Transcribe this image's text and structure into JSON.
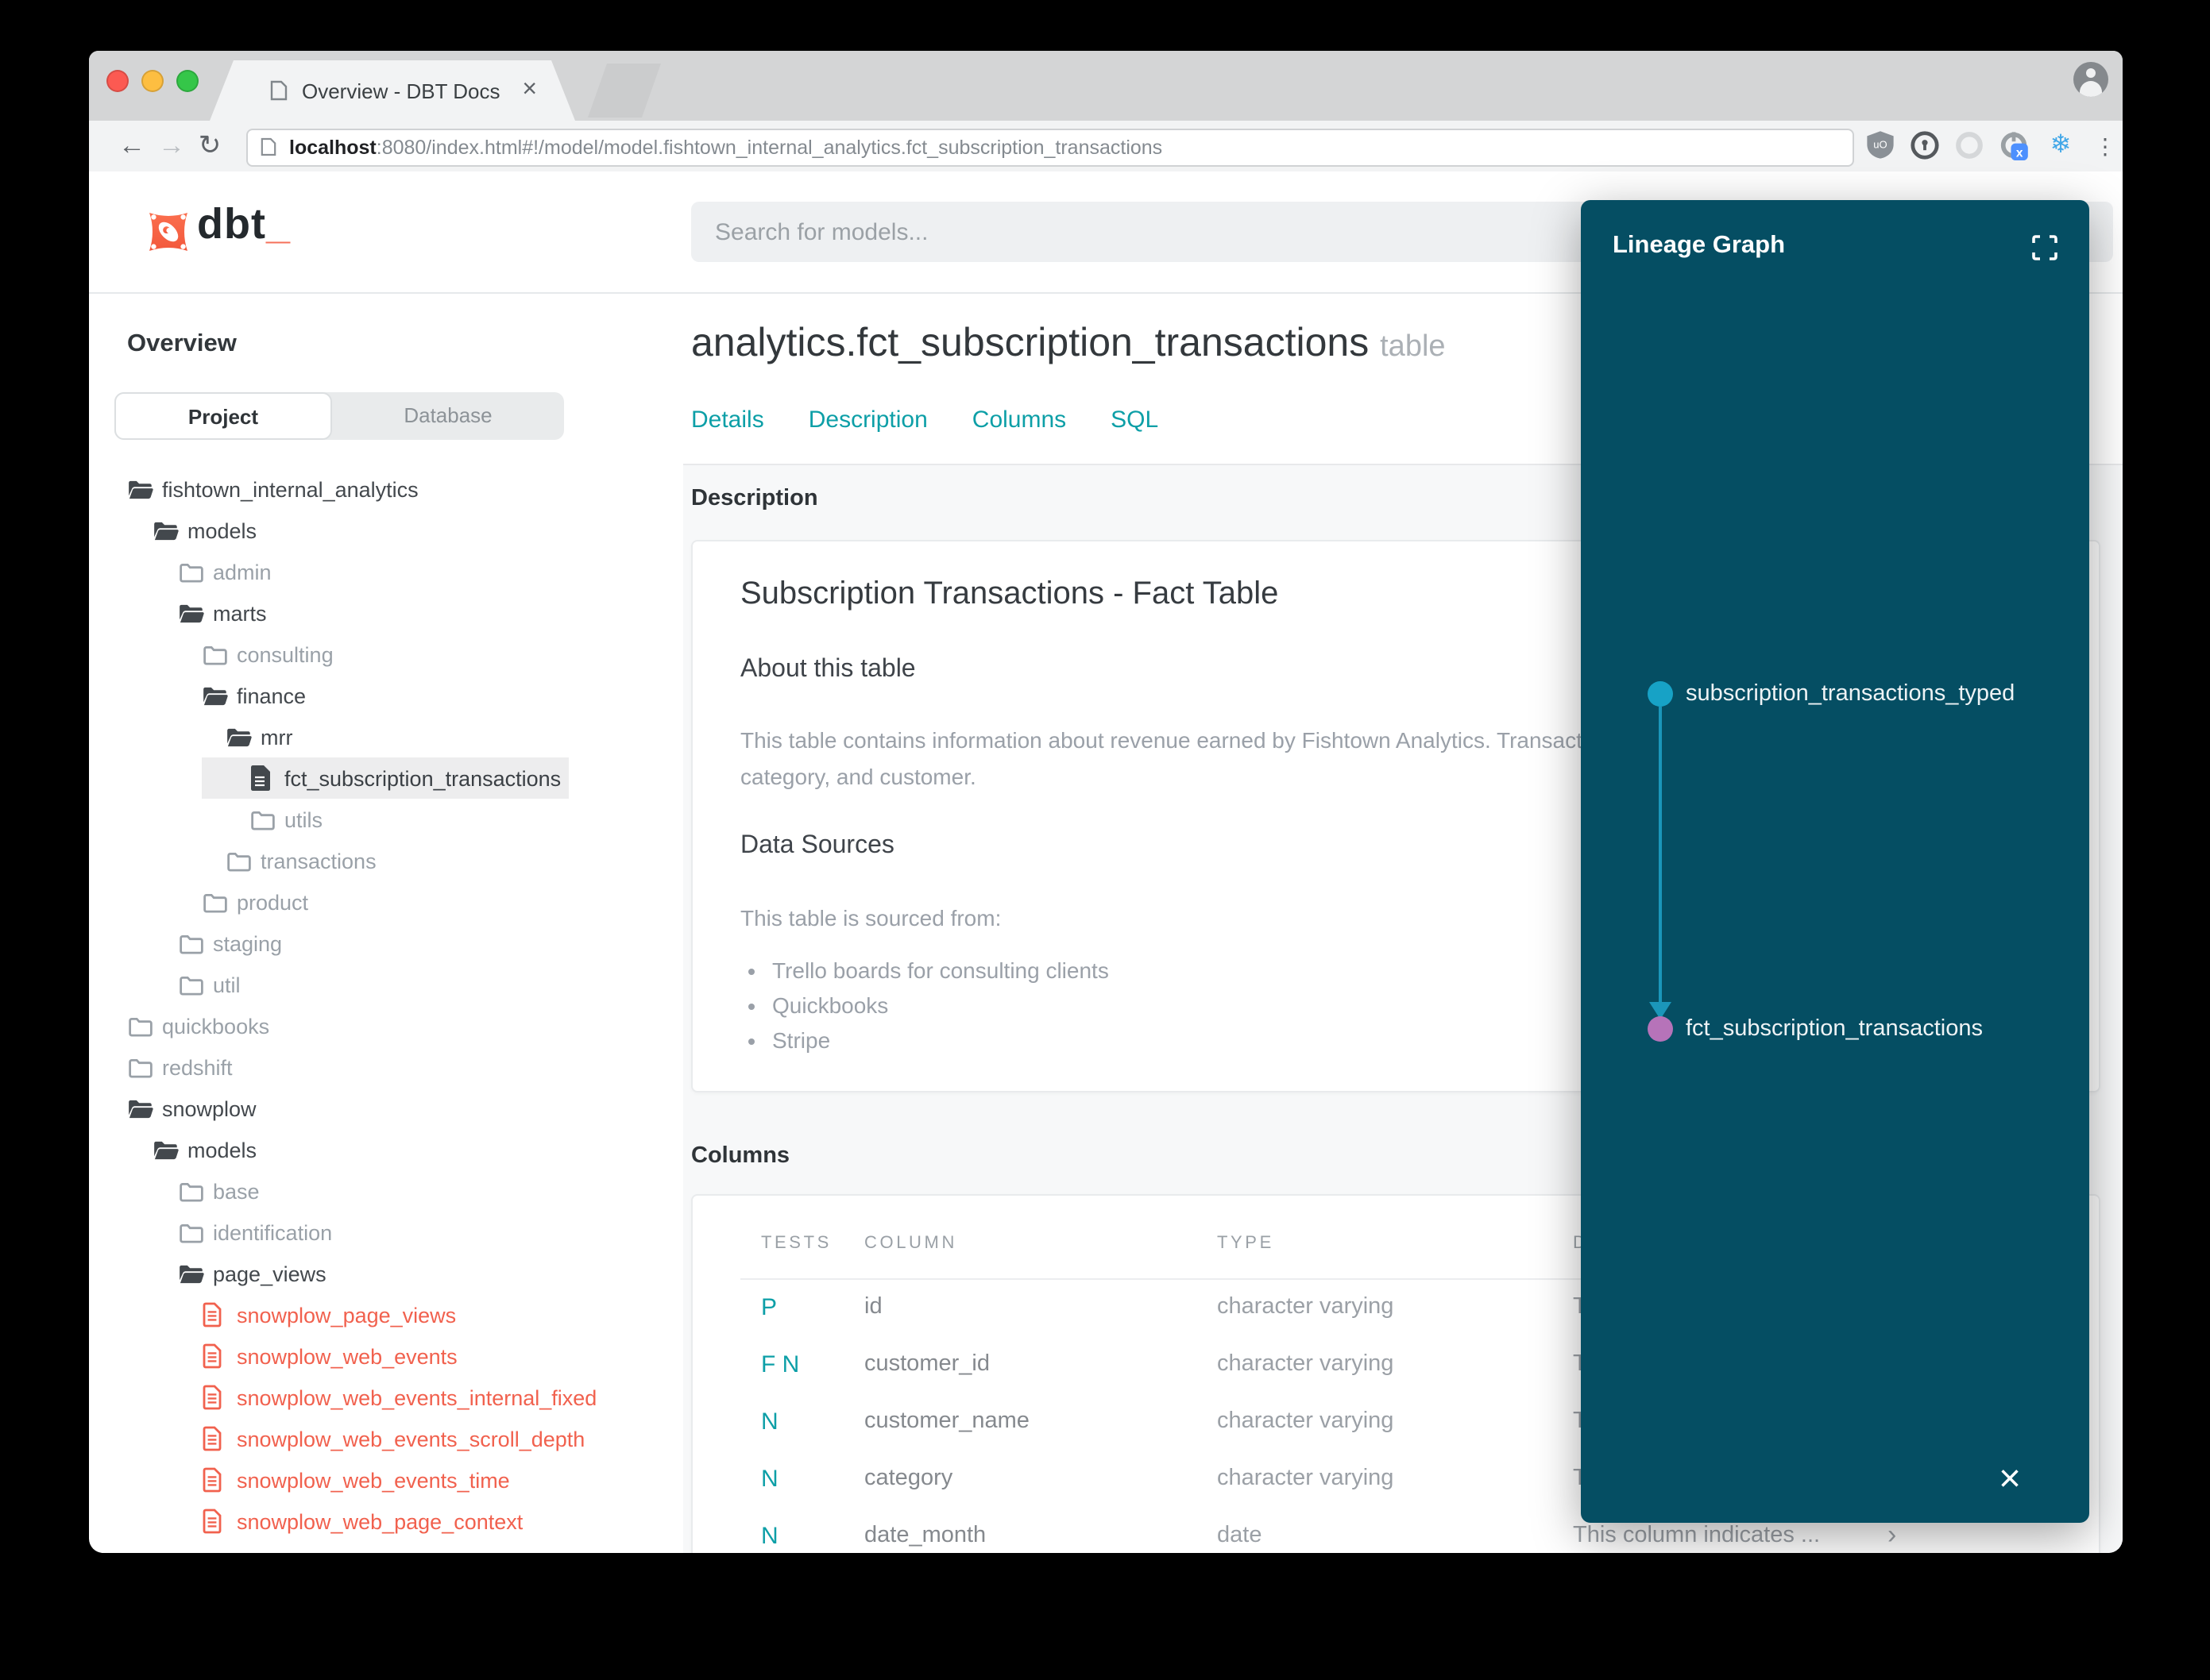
{
  "browser": {
    "tab": {
      "title": "Overview - DBT Docs",
      "close_label": "×"
    },
    "url": {
      "host": "localhost",
      "path": ":8080/index.html#!/model/model.fishtown_internal_analytics.fct_subscription_transactions"
    },
    "nav": {
      "back": "←",
      "forward": "→",
      "reload": "↻"
    },
    "extensions": [
      "ublock-shield",
      "1password",
      "pocket",
      "power-x",
      "snowflake"
    ],
    "snowflake_glyph": "❄",
    "menu_glyph": "⋮"
  },
  "header": {
    "logo_text": "dbt",
    "logo_cursor": "_",
    "search_placeholder": "Search for models..."
  },
  "sidebar": {
    "title": "Overview",
    "view_tabs": [
      {
        "label": "Project",
        "active": true
      },
      {
        "label": "Database",
        "active": false
      }
    ],
    "tree": [
      {
        "label": "fishtown_internal_analytics",
        "level": 0,
        "type": "folder-open"
      },
      {
        "label": "models",
        "level": 1,
        "type": "folder-open"
      },
      {
        "label": "admin",
        "level": 2,
        "type": "folder-closed"
      },
      {
        "label": "marts",
        "level": 2,
        "type": "folder-open"
      },
      {
        "label": "consulting",
        "level": 3,
        "type": "folder-closed"
      },
      {
        "label": "finance",
        "level": 3,
        "type": "folder-open"
      },
      {
        "label": "mrr",
        "level": 4,
        "type": "folder-open"
      },
      {
        "label": "fct_subscription_transactions",
        "level": 5,
        "type": "file-model",
        "selected": true
      },
      {
        "label": "utils",
        "level": 5,
        "type": "folder-closed"
      },
      {
        "label": "transactions",
        "level": 4,
        "type": "folder-closed"
      },
      {
        "label": "product",
        "level": 3,
        "type": "folder-closed"
      },
      {
        "label": "staging",
        "level": 2,
        "type": "folder-closed"
      },
      {
        "label": "util",
        "level": 2,
        "type": "folder-closed"
      },
      {
        "label": "quickbooks",
        "level": 0,
        "type": "folder-closed"
      },
      {
        "label": "redshift",
        "level": 0,
        "type": "folder-closed"
      },
      {
        "label": "snowplow",
        "level": 0,
        "type": "folder-open"
      },
      {
        "label": "models",
        "level": 1,
        "type": "folder-open"
      },
      {
        "label": "base",
        "level": 2,
        "type": "folder-closed"
      },
      {
        "label": "identification",
        "level": 2,
        "type": "folder-closed"
      },
      {
        "label": "page_views",
        "level": 2,
        "type": "folder-open"
      },
      {
        "label": "snowplow_page_views",
        "level": 3,
        "type": "file-error"
      },
      {
        "label": "snowplow_web_events",
        "level": 3,
        "type": "file-error"
      },
      {
        "label": "snowplow_web_events_internal_fixed",
        "level": 3,
        "type": "file-error"
      },
      {
        "label": "snowplow_web_events_scroll_depth",
        "level": 3,
        "type": "file-error"
      },
      {
        "label": "snowplow_web_events_time",
        "level": 3,
        "type": "file-error"
      },
      {
        "label": "snowplow_web_page_context",
        "level": 3,
        "type": "file-error"
      }
    ]
  },
  "main": {
    "title": "analytics.fct_subscription_transactions",
    "title_badge": "table",
    "tabs": [
      "Details",
      "Description",
      "Columns",
      "SQL"
    ],
    "description": {
      "section_title": "Description",
      "doc_title": "Subscription Transactions - Fact Table",
      "about_heading": "About this table",
      "about_lines": [
        "This table contains information about revenue earned by Fishtown Analytics. Transactions are grouped by month,",
        "category, and customer."
      ],
      "sources_heading": "Data Sources",
      "sources_intro": "This table is sourced from:",
      "sources": [
        "Trello boards for consulting clients",
        "Quickbooks",
        "Stripe"
      ]
    },
    "columns": {
      "section_title": "Columns",
      "headers": [
        "TESTS",
        "COLUMN",
        "TYPE",
        "DESCRIPTION"
      ],
      "rows": [
        {
          "tests": "P",
          "column": "id",
          "type": "character varying",
          "description": "This ...",
          "expander": "›"
        },
        {
          "tests": "F N",
          "column": "customer_id",
          "type": "character varying",
          "description": "This ...",
          "expander": "›"
        },
        {
          "tests": "N",
          "column": "customer_name",
          "type": "character varying",
          "description": "This ...",
          "expander": "›"
        },
        {
          "tests": "N",
          "column": "category",
          "type": "character varying",
          "description": "This ...",
          "expander": "›"
        },
        {
          "tests": "N",
          "column": "date_month",
          "type": "date",
          "description": "This column indicates ...",
          "expander": "›"
        }
      ]
    }
  },
  "lineage": {
    "title": "Lineage Graph",
    "nodes": [
      {
        "label": "subscription_transactions_typed",
        "color": "#17a2c6"
      },
      {
        "label": "fct_subscription_transactions",
        "color": "#b673b9"
      }
    ],
    "edge": {
      "color": "#1b96ba"
    },
    "close_label": "×"
  },
  "colors": {
    "accent_teal": "#0d9fa7",
    "panel_bg": "#054E63",
    "file_error": "#f1614e",
    "traffic_lights": [
      "#fc5a52",
      "#fdbe41",
      "#35c649"
    ]
  }
}
